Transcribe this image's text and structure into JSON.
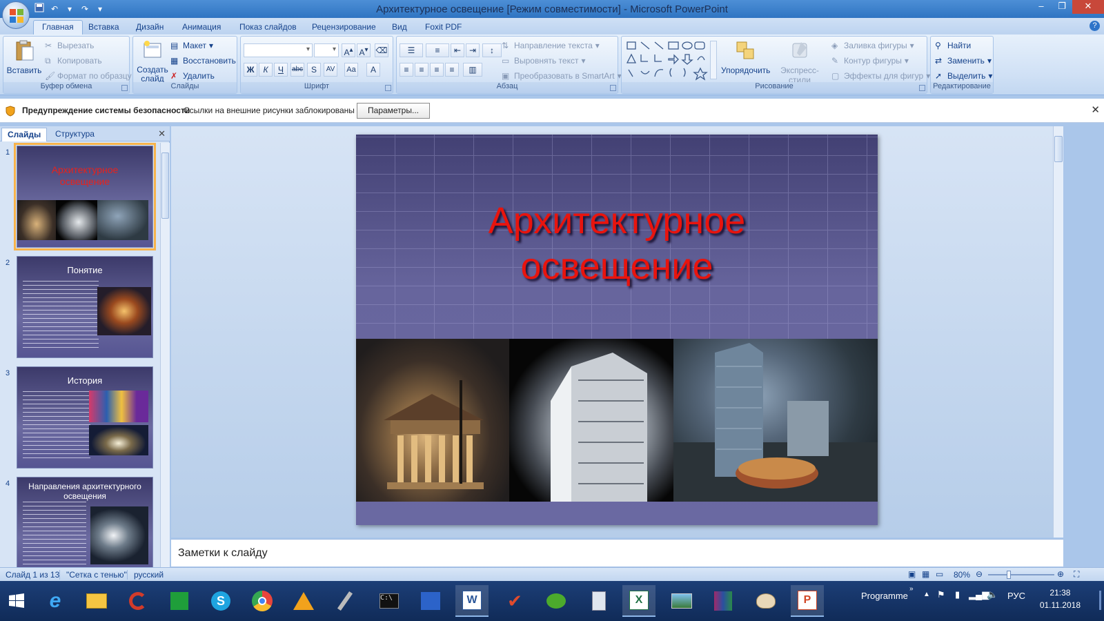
{
  "window": {
    "title": "Архитектурное освещение [Режим совместимости] - Microsoft PowerPoint"
  },
  "ribbon_tabs": [
    "Главная",
    "Вставка",
    "Дизайн",
    "Анимация",
    "Показ слайдов",
    "Рецензирование",
    "Вид",
    "Foxit PDF"
  ],
  "ribbon": {
    "clipboard": {
      "label": "Буфер обмена",
      "paste": "Вставить",
      "cut": "Вырезать",
      "copy": "Копировать",
      "format_painter": "Формат по образцу"
    },
    "slides": {
      "label": "Слайды",
      "new_slide_line1": "Создать",
      "new_slide_line2": "слайд",
      "layout": "Макет",
      "reset": "Восстановить",
      "delete": "Удалить"
    },
    "font": {
      "label": "Шрифт"
    },
    "paragraph": {
      "label": "Абзац",
      "text_direction": "Направление текста",
      "align_text": "Выровнять текст",
      "smartart": "Преобразовать в SmartArt"
    },
    "drawing": {
      "label": "Рисование",
      "arrange": "Упорядочить",
      "quick_styles": "Экспресс-стили",
      "shape_fill": "Заливка фигуры",
      "shape_outline": "Контур фигуры",
      "shape_effects": "Эффекты для фигур"
    },
    "editing": {
      "label": "Редактирование",
      "find": "Найти",
      "replace": "Заменить",
      "select": "Выделить"
    }
  },
  "security_bar": {
    "title": "Предупреждение системы безопасности",
    "message": "Ссылки на внешние рисунки заблокированы",
    "button": "Параметры..."
  },
  "left_pane": {
    "tabs": [
      "Слайды",
      "Структура"
    ],
    "slides": [
      {
        "num": "1",
        "title": "Архитектурное освещение"
      },
      {
        "num": "2",
        "title": "Понятие"
      },
      {
        "num": "3",
        "title": "История"
      },
      {
        "num": "4",
        "title": "Направления архитектурного освещения"
      }
    ]
  },
  "slide": {
    "title_line1": "Архитектурное",
    "title_line2": "освещение"
  },
  "notes": {
    "placeholder": "Заметки к слайду"
  },
  "status_bar": {
    "slide_info": "Слайд 1 из 13",
    "theme": "\"Сетка с тенью\"",
    "language": "русский",
    "zoom": "80%"
  },
  "taskbar": {
    "programme_label": "Programme",
    "lang": "РУС",
    "time": "21:38",
    "date": "01.11.2018"
  },
  "colors": {
    "slide_title": "#e8140e",
    "accent": "#15428b"
  }
}
